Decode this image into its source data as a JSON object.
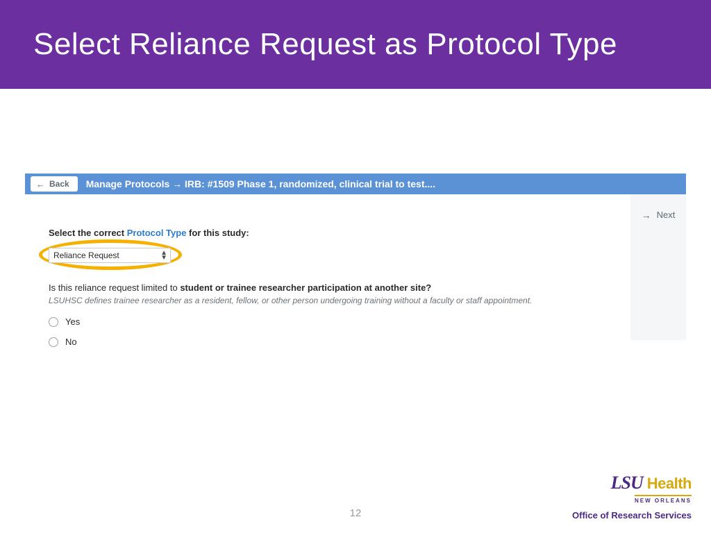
{
  "slide": {
    "title": "Select Reliance Request as Protocol Type",
    "page_number": "12"
  },
  "app": {
    "back_label": "Back",
    "breadcrumb": "Manage Protocols → IRB: #1509 Phase 1, randomized, clinical trial to test....",
    "next_label": "Next"
  },
  "form": {
    "prompt_prefix": "Select the correct ",
    "prompt_link": "Protocol Type",
    "prompt_suffix": " for this study:",
    "select_value": "Reliance Request",
    "question_prefix": "Is this reliance request limited to ",
    "question_bold": "student or trainee researcher participation at another site?",
    "helper": "LSUHSC defines trainee researcher as a resident, fellow, or other person undergoing training without a faculty or staff appointment.",
    "options": {
      "yes": "Yes",
      "no": "No"
    }
  },
  "footer": {
    "lsu": "LSU",
    "health": "Health",
    "city": "NEW ORLEANS",
    "office": "Office of Research Services"
  }
}
